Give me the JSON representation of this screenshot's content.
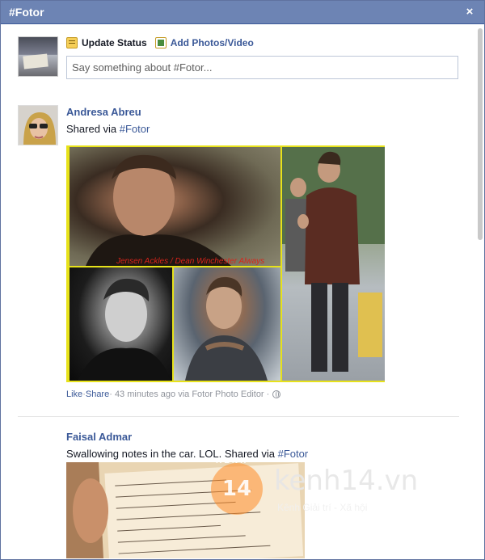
{
  "dialog": {
    "title": "#Fotor",
    "close_glyph": "×"
  },
  "composer": {
    "tab_status_label": "Update Status",
    "tab_photo_label": "Add Photos/Video",
    "input_placeholder": "Say something about #Fotor..."
  },
  "posts": [
    {
      "author": "Andresa Abreu",
      "body_prefix": "Shared via ",
      "hashtag": "#Fotor",
      "image_caption": "Jensen Ackles / Dean Winchester Always",
      "like_label": "Like",
      "share_label": "Share",
      "meta_text": " · 43 minutes ago via Fotor Photo Editor · ",
      "separator": " · "
    },
    {
      "author": "Faisal Admar",
      "body_prefix": "Swallowing notes in the car. LOL. Shared via ",
      "hashtag": "#Fotor"
    }
  ],
  "watermark": {
    "top_text": "KENH",
    "badge_text": "14",
    "site": "kenh14.vn",
    "tagline": "Kênh Giải trí - Xã hội"
  },
  "icons": {
    "close": "close-icon",
    "status": "status-note-icon",
    "photo": "photo-icon",
    "privacy": "globe-icon"
  },
  "colors": {
    "titlebar": "#6d84b4",
    "link": "#3b5998",
    "collage_border": "#e7e21a",
    "caption": "#d9241a"
  }
}
